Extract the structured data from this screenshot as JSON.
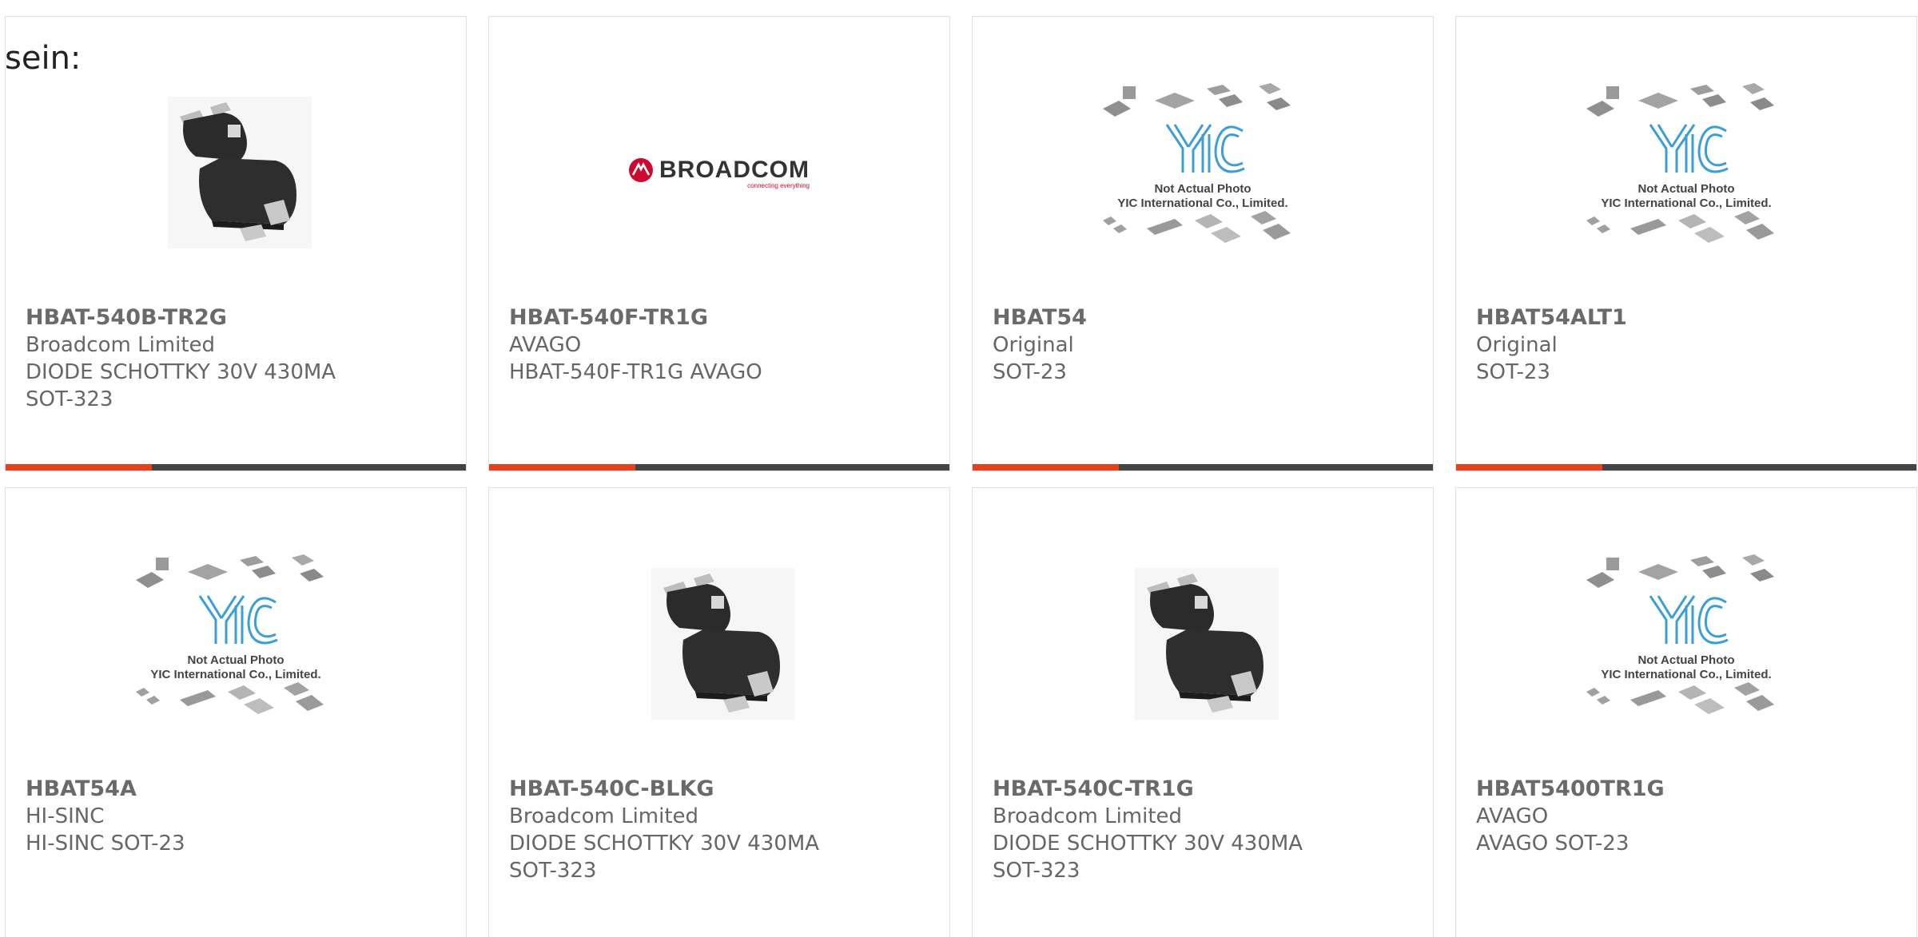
{
  "intro": "sein:",
  "colors": {
    "accent": "#e8401c",
    "bar": "#444444",
    "border": "#dedede",
    "text": "#666666"
  },
  "placeholder": {
    "line1": "Not Actual Photo",
    "line2": "YIC International Co., Limited.",
    "logo": "YIC"
  },
  "brand_logo": {
    "name": "BROADCOM",
    "tagline": "connecting everything"
  },
  "products": [
    {
      "part": "HBAT-540B-TR2G",
      "maker": "Broadcom Limited",
      "desc": "DIODE SCHOTTKY 30V 430MA",
      "pkg": "SOT-323",
      "image": "sot323-chip"
    },
    {
      "part": "HBAT-540F-TR1G",
      "maker": "AVAGO",
      "desc": "HBAT-540F-TR1G AVAGO",
      "pkg": "",
      "image": "broadcom-logo"
    },
    {
      "part": "HBAT54",
      "maker": "Original",
      "desc": "SOT-23",
      "pkg": "",
      "image": "yic-placeholder"
    },
    {
      "part": "HBAT54ALT1",
      "maker": "Original",
      "desc": "SOT-23",
      "pkg": "",
      "image": "yic-placeholder"
    },
    {
      "part": "HBAT54A",
      "maker": "HI-SINC",
      "desc": "HI-SINC SOT-23",
      "pkg": "",
      "image": "yic-placeholder"
    },
    {
      "part": "HBAT-540C-BLKG",
      "maker": "Broadcom Limited",
      "desc": "DIODE SCHOTTKY 30V 430MA",
      "pkg": "SOT-323",
      "image": "sot323-chip"
    },
    {
      "part": "HBAT-540C-TR1G",
      "maker": "Broadcom Limited",
      "desc": "DIODE SCHOTTKY 30V 430MA",
      "pkg": "SOT-323",
      "image": "sot323-chip"
    },
    {
      "part": "HBAT5400TR1G",
      "maker": "AVAGO",
      "desc": "AVAGO SOT-23",
      "pkg": "",
      "image": "yic-placeholder"
    }
  ]
}
